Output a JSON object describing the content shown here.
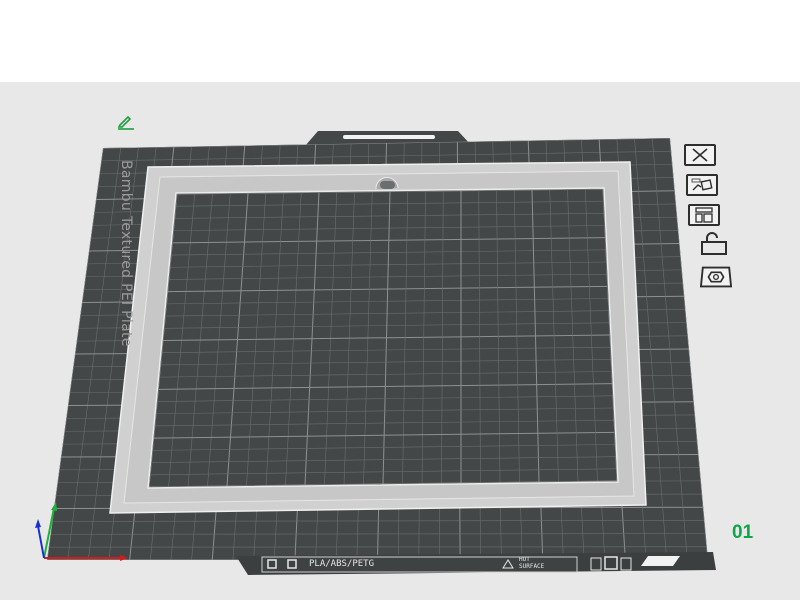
{
  "plate": {
    "brand_label": "Bambu Textured PEI Plate",
    "material_label": "PLA/ABS/PETG",
    "hot_surface_line1": "HOT",
    "hot_surface_line2": "SURFACE",
    "number": "01"
  },
  "colors": {
    "plate": "#444748",
    "grid_minor": "#6b6e6f",
    "grid_major": "#8d9091",
    "frame": "#d0d0d0",
    "plate_number": "#0fa64a",
    "viewport_bg": "#e8e8e8",
    "axis_x": "#d11c1c",
    "axis_y": "#1db33a",
    "axis_z": "#1a2fd1",
    "edit_icon": "#1f9e3c"
  },
  "side_buttons": [
    {
      "name": "delete-plate-button",
      "icon": "close-icon"
    },
    {
      "name": "auto-orient-button",
      "icon": "auto-orient-icon"
    },
    {
      "name": "arrange-button",
      "icon": "arrange-icon"
    },
    {
      "name": "lock-plate-button",
      "icon": "lock-icon"
    },
    {
      "name": "plate-settings-button",
      "icon": "gear-icon"
    }
  ]
}
